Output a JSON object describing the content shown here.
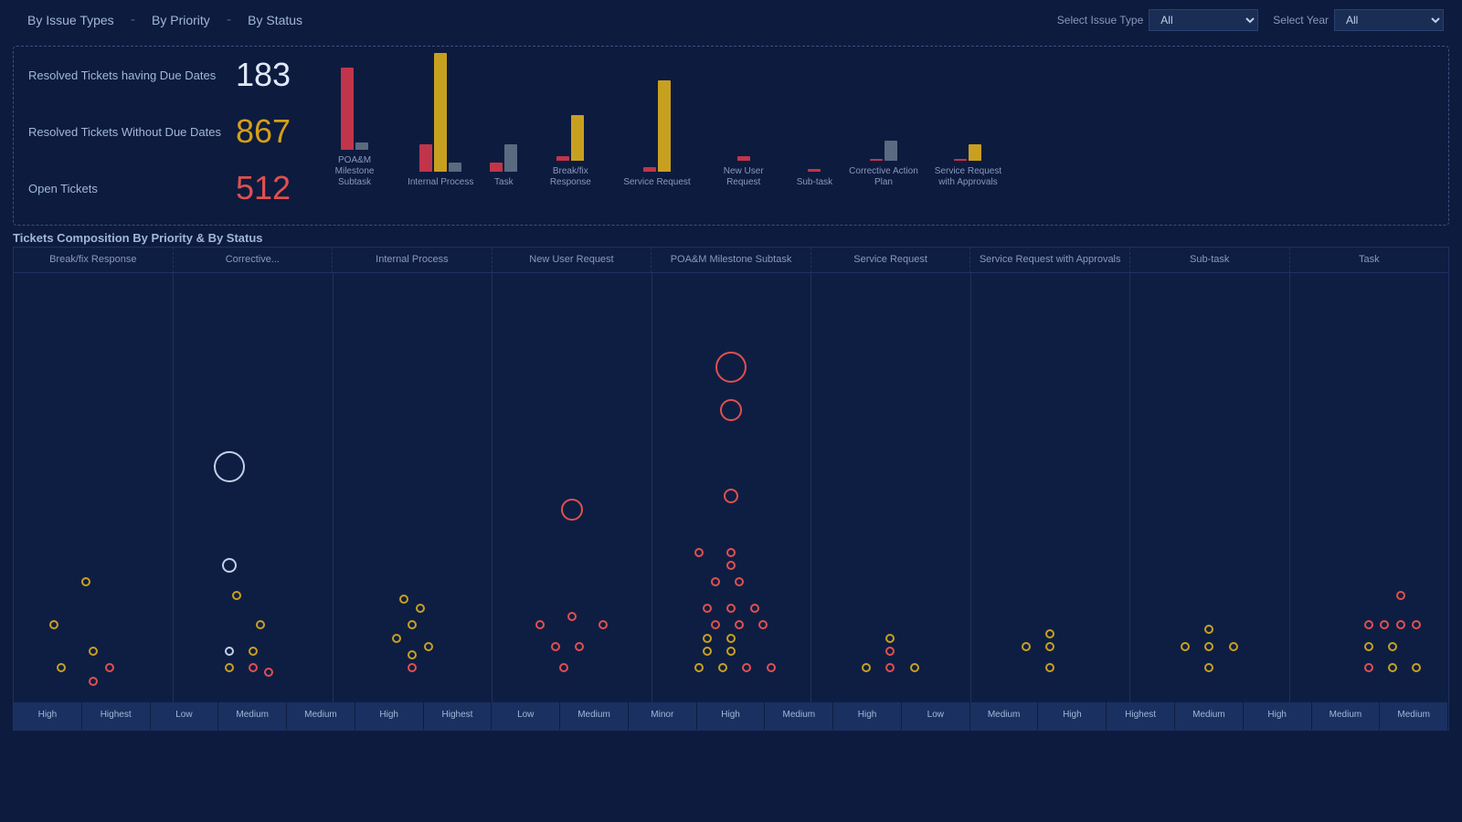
{
  "nav": {
    "tabs": [
      {
        "id": "by-issue-types",
        "label": "By Issue Types"
      },
      {
        "id": "by-priority",
        "label": "By Priority"
      },
      {
        "id": "by-status",
        "label": "By Status"
      }
    ],
    "filters": [
      {
        "id": "issue-type",
        "label": "Select Issue Type",
        "value": "All"
      },
      {
        "id": "year",
        "label": "Select Year",
        "value": "All"
      }
    ]
  },
  "summary": {
    "resolved_with_due": {
      "label": "Resolved Tickets having Due Dates",
      "value": "183"
    },
    "resolved_without_due": {
      "label": "Resolved Tickets Without Due Dates",
      "value": "867"
    },
    "open_tickets": {
      "label": "Open Tickets",
      "value": "512"
    }
  },
  "bar_chart": {
    "groups": [
      {
        "label": "POA&M Milestone\nSubtask",
        "red": 90,
        "yellow": 0,
        "gray": 8
      },
      {
        "label": "Internal Process",
        "red": 30,
        "yellow": 130,
        "gray": 10
      },
      {
        "label": "Task",
        "red": 10,
        "yellow": 0,
        "gray": 30
      },
      {
        "label": "Break/fix Response",
        "red": 5,
        "yellow": 50,
        "gray": 0
      },
      {
        "label": "Service Request",
        "red": 5,
        "yellow": 100,
        "gray": 0
      },
      {
        "label": "New User Request",
        "red": 5,
        "yellow": 0,
        "gray": 0
      },
      {
        "label": "Sub-task",
        "red": 3,
        "yellow": 0,
        "gray": 0
      },
      {
        "label": "Corrective Action\nPlan",
        "red": 2,
        "yellow": 0,
        "gray": 22
      },
      {
        "label": "Service Request\nwith Approvals",
        "red": 2,
        "yellow": 18,
        "gray": 0
      }
    ]
  },
  "scatter": {
    "columns": [
      "Break/fix Response",
      "Corrective...",
      "Internal Process",
      "New User Request",
      "POA&M Milestone Subtask",
      "Service Request",
      "Service Request with Approvals",
      "Sub-task",
      "Task"
    ],
    "priorities": [
      "High",
      "Highest",
      "Low",
      "Medium",
      "Medium",
      "High",
      "Highest",
      "Low",
      "Medium",
      "Minor",
      "High",
      "Medium",
      "High",
      "Low",
      "Medium",
      "High",
      "Highest",
      "Medium",
      "High",
      "Medium",
      "Medium"
    ]
  },
  "section_title": "Tickets Composition By Priority & By Status"
}
